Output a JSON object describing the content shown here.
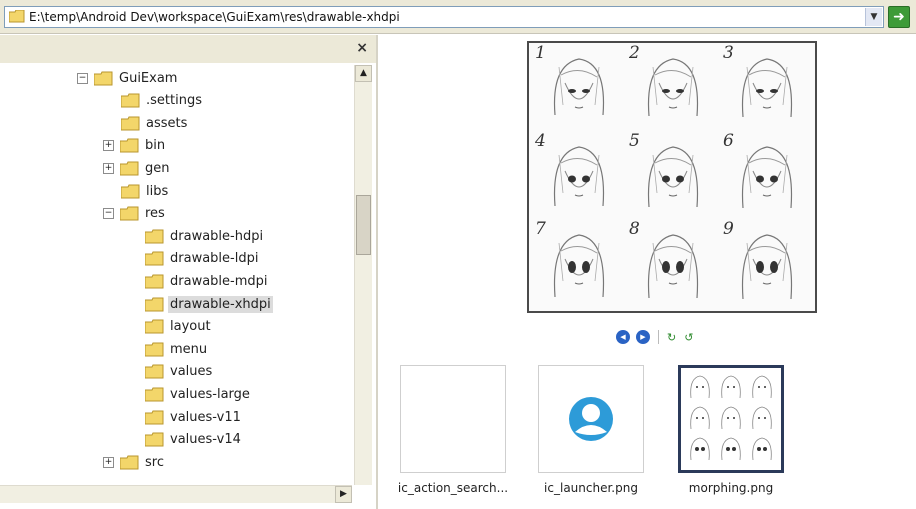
{
  "address_bar": {
    "path": "E:\\temp\\Android Dev\\workspace\\GuiExam\\res\\drawable-xhdpi",
    "dropdown_icon": "chevron-down-icon",
    "go_icon": "go-arrow-icon",
    "go_color": "#3e9b38"
  },
  "folder_pane": {
    "close_label": "×",
    "tree": [
      {
        "label": "GuiExam",
        "toggle": "−",
        "level": 0
      },
      {
        "label": ".settings",
        "toggle": "",
        "level": 1
      },
      {
        "label": "assets",
        "toggle": "",
        "level": 1
      },
      {
        "label": "bin",
        "toggle": "+",
        "level": 1
      },
      {
        "label": "gen",
        "toggle": "+",
        "level": 1
      },
      {
        "label": "libs",
        "toggle": "",
        "level": 1
      },
      {
        "label": "res",
        "toggle": "−",
        "level": 1
      },
      {
        "label": "drawable-hdpi",
        "toggle": "",
        "level": 2
      },
      {
        "label": "drawable-ldpi",
        "toggle": "",
        "level": 2
      },
      {
        "label": "drawable-mdpi",
        "toggle": "",
        "level": 2
      },
      {
        "label": "drawable-xhdpi",
        "toggle": "",
        "level": 2,
        "selected": true
      },
      {
        "label": "layout",
        "toggle": "",
        "level": 2
      },
      {
        "label": "menu",
        "toggle": "",
        "level": 2
      },
      {
        "label": "values",
        "toggle": "",
        "level": 2
      },
      {
        "label": "values-large",
        "toggle": "",
        "level": 2
      },
      {
        "label": "values-v11",
        "toggle": "",
        "level": 2
      },
      {
        "label": "values-v14",
        "toggle": "",
        "level": 2
      },
      {
        "label": "src",
        "toggle": "+",
        "level": 1
      }
    ]
  },
  "preview": {
    "numbers": [
      "1",
      "2",
      "3",
      "4",
      "5",
      "6",
      "7",
      "8",
      "9"
    ]
  },
  "preview_controls": [
    "previous-image-icon",
    "next-image-icon",
    "rotate-clockwise-icon",
    "rotate-counterclockwise-icon"
  ],
  "files": [
    {
      "name": "ic_action_search...",
      "selected": false
    },
    {
      "name": "ic_launcher.png",
      "selected": false
    },
    {
      "name": "morphing.png",
      "selected": true
    }
  ],
  "colors": {
    "folder": "#f3d66a",
    "launcher": "#2d9bd8",
    "control": "#2a63c4"
  }
}
